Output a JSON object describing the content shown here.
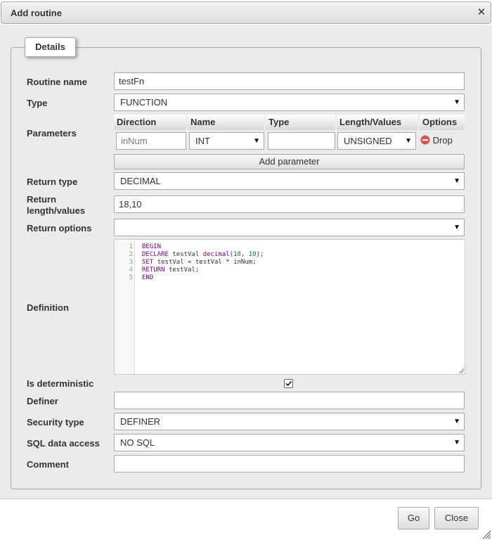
{
  "dialog": {
    "title": "Add routine"
  },
  "fieldset": {
    "legend": "Details"
  },
  "labels": {
    "routine_name": "Routine name",
    "type": "Type",
    "parameters": "Parameters",
    "return_type": "Return type",
    "return_length_1": "Return",
    "return_length_2": "length/values",
    "return_options": "Return options",
    "definition": "Definition",
    "is_deterministic": "Is deterministic",
    "definer": "Definer",
    "security_type": "Security type",
    "sql_data_access": "SQL data access",
    "comment": "Comment"
  },
  "values": {
    "routine_name": "testFn",
    "type": "FUNCTION",
    "return_type": "DECIMAL",
    "return_length": "18,10",
    "return_options": "",
    "is_deterministic": true,
    "definer": "",
    "security_type": "DEFINER",
    "sql_data_access": "NO SQL",
    "comment": ""
  },
  "parameters": {
    "headers": [
      "Direction",
      "Name",
      "Type",
      "Length/Values",
      "Options"
    ],
    "row": {
      "direction": "inNum",
      "name": "INT",
      "type": "",
      "length": "UNSIGNED",
      "drop_label": "Drop"
    },
    "add_label": "Add parameter"
  },
  "definition": {
    "line_numbers": [
      "1",
      "2",
      "3",
      "4",
      "5"
    ],
    "lines": [
      "BEGIN",
      "DECLARE testVal decimal(18, 10);",
      "SET testVal = testVal * inNum;",
      "RETURN testVal;",
      "END"
    ]
  },
  "footer": {
    "go_label": "Go",
    "close_label": "Close"
  },
  "icons": {
    "close": "close-icon",
    "drop": "drop-icon",
    "caret": "chevron-down-icon",
    "checkbox": "checkbox-checked-icon",
    "resize": "resize-grip-icon"
  }
}
